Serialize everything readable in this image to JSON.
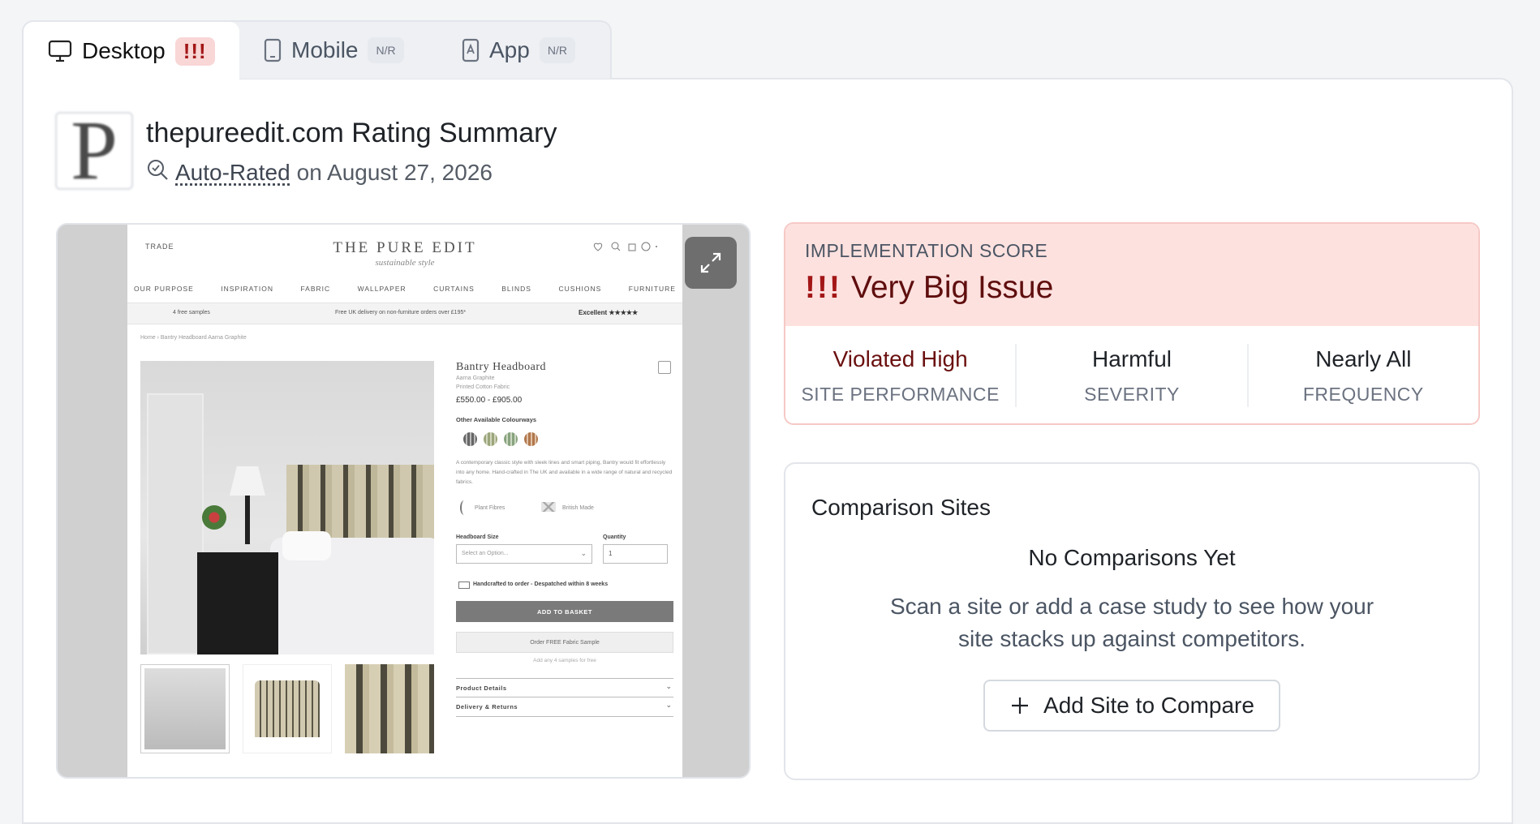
{
  "tabs": [
    {
      "label": "Desktop",
      "badge": "!!!",
      "active": true
    },
    {
      "label": "Mobile",
      "badge": "N/R"
    },
    {
      "label": "App",
      "badge": "N/R"
    }
  ],
  "header": {
    "logo_letter": "P",
    "title": "thepureedit.com Rating Summary",
    "rated_link": "Auto-Rated",
    "rated_suffix": "on August 27, 2026"
  },
  "screenshot": {
    "trade": "TRADE",
    "brand": "THE PURE EDIT",
    "brand_tagline": "sustainable style",
    "nav": [
      "OUR PURPOSE",
      "INSPIRATION",
      "FABRIC",
      "WALLPAPER",
      "CURTAINS",
      "BLINDS",
      "CUSHIONS",
      "FURNITURE"
    ],
    "promo_left": "4 free samples",
    "promo_mid": "Free UK delivery on non-furniture orders over £195*",
    "promo_right": "Excellent ★★★★★",
    "breadcrumb": "Home  ›  Bantry Headboard Aarna Graphite",
    "product_name": "Bantry Headboard",
    "product_sub1": "Aarna Graphite",
    "product_sub2": "Printed Cotton Fabric",
    "price": "£550.00 - £905.00",
    "colourways_label": "Other Available Colourways",
    "description": "A contemporary classic style with sleek lines and smart piping, Bantry would fit effortlessly into any home. Hand-crafted in The UK and available in a wide range of natural and recycled fabrics.",
    "feature1": "Plant Fibres",
    "feature2": "British Made",
    "size_label": "Headboard Size",
    "size_placeholder": "Select an Option...",
    "qty_label": "Quantity",
    "qty_value": "1",
    "dispatch": "Handcrafted to order - Despatched within 8 weeks",
    "add_to_basket": "ADD TO BASKET",
    "free_sample": "Order FREE Fabric Sample",
    "samples_note": "Add any 4 samples for free",
    "accordion1": "Product Details",
    "accordion2": "Delivery & Returns"
  },
  "score": {
    "label": "IMPLEMENTATION SCORE",
    "bang": "!!!",
    "value": "Very Big Issue",
    "metrics": [
      {
        "value": "Violated High",
        "key": "SITE PERFORMANCE"
      },
      {
        "value": "Harmful",
        "key": "SEVERITY"
      },
      {
        "value": "Nearly All",
        "key": "FREQUENCY"
      }
    ]
  },
  "comparison": {
    "title": "Comparison Sites",
    "empty_title": "No Comparisons Yet",
    "empty_desc": "Scan a site or add a case study to see how your site stacks up against competitors.",
    "button": "Add Site to Compare"
  },
  "colors": {
    "accent_red": "#a31717",
    "score_bg": "#fde1df"
  }
}
